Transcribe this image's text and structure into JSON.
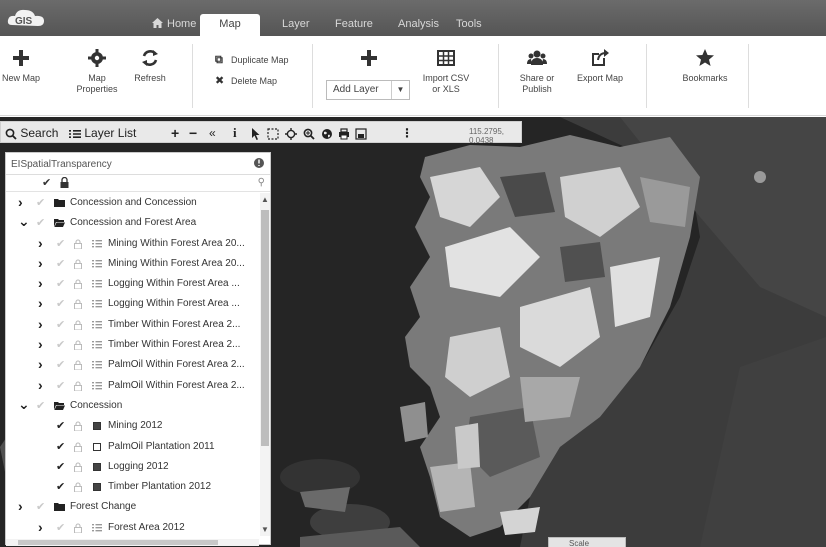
{
  "app": {
    "logo_text": "GIS"
  },
  "nav": {
    "tabs": [
      {
        "label": "Home"
      },
      {
        "label": "Map"
      },
      {
        "label": "Layer"
      },
      {
        "label": "Feature"
      },
      {
        "label": "Analysis"
      },
      {
        "label": "Tools"
      }
    ],
    "active": "Map"
  },
  "ribbon": {
    "new_map": "New Map",
    "map_properties": "Map Properties",
    "refresh": "Refresh",
    "duplicate_map": "Duplicate Map",
    "delete_map": "Delete Map",
    "add_layer": "Add Layer",
    "import_csv": "Import CSV or XLS",
    "share_publish": "Share or Publish",
    "export_map": "Export Map",
    "bookmarks": "Bookmarks"
  },
  "toolbar": {
    "search": "Search",
    "layer_list": "Layer List",
    "coords": "115.2795, 0.0438"
  },
  "panel": {
    "title": "EISpatialTransparency",
    "rows": [
      {
        "label": "Concession and Concession",
        "type": "folder",
        "expand": "right",
        "checked": false
      },
      {
        "label": "Concession and Forest Area",
        "type": "folder-open",
        "expand": "down",
        "checked": false
      },
      {
        "label": "Mining Within Forest Area 20...",
        "type": "layer",
        "expand": "right",
        "checked": false
      },
      {
        "label": "Mining Within Forest Area 20...",
        "type": "layer",
        "expand": "right",
        "checked": false
      },
      {
        "label": "Logging Within Forest Area ...",
        "type": "layer",
        "expand": "right",
        "checked": false
      },
      {
        "label": "Logging Within Forest Area ...",
        "type": "layer",
        "expand": "right",
        "checked": false
      },
      {
        "label": "Timber Within Forest Area 2...",
        "type": "layer",
        "expand": "right",
        "checked": false
      },
      {
        "label": "Timber Within Forest Area 2...",
        "type": "layer",
        "expand": "right",
        "checked": false
      },
      {
        "label": "PalmOil Within Forest Area 2...",
        "type": "layer",
        "expand": "right",
        "checked": false
      },
      {
        "label": "PalmOil Within Forest Area 2...",
        "type": "layer",
        "expand": "right",
        "checked": false
      },
      {
        "label": "Concession",
        "type": "folder-open",
        "expand": "down",
        "checked": false
      },
      {
        "label": "Mining 2012",
        "type": "square-fill",
        "expand": "",
        "checked": true
      },
      {
        "label": "PalmOil Plantation 2011",
        "type": "square",
        "expand": "",
        "checked": true
      },
      {
        "label": "Logging 2012",
        "type": "square-fill",
        "expand": "",
        "checked": true
      },
      {
        "label": "Timber Plantation 2012",
        "type": "square-fill",
        "expand": "",
        "checked": true
      },
      {
        "label": "Forest Change",
        "type": "folder",
        "expand": "right",
        "checked": false
      },
      {
        "label": "Forest Area 2012",
        "type": "layer",
        "expand": "right",
        "checked": false
      }
    ]
  },
  "overview": {
    "label": "Scale"
  },
  "colors": {
    "nav_bg": "#5e5e5e",
    "map_bg": "#2a2a2a",
    "toolbar_bg": "#e9e9e9"
  }
}
